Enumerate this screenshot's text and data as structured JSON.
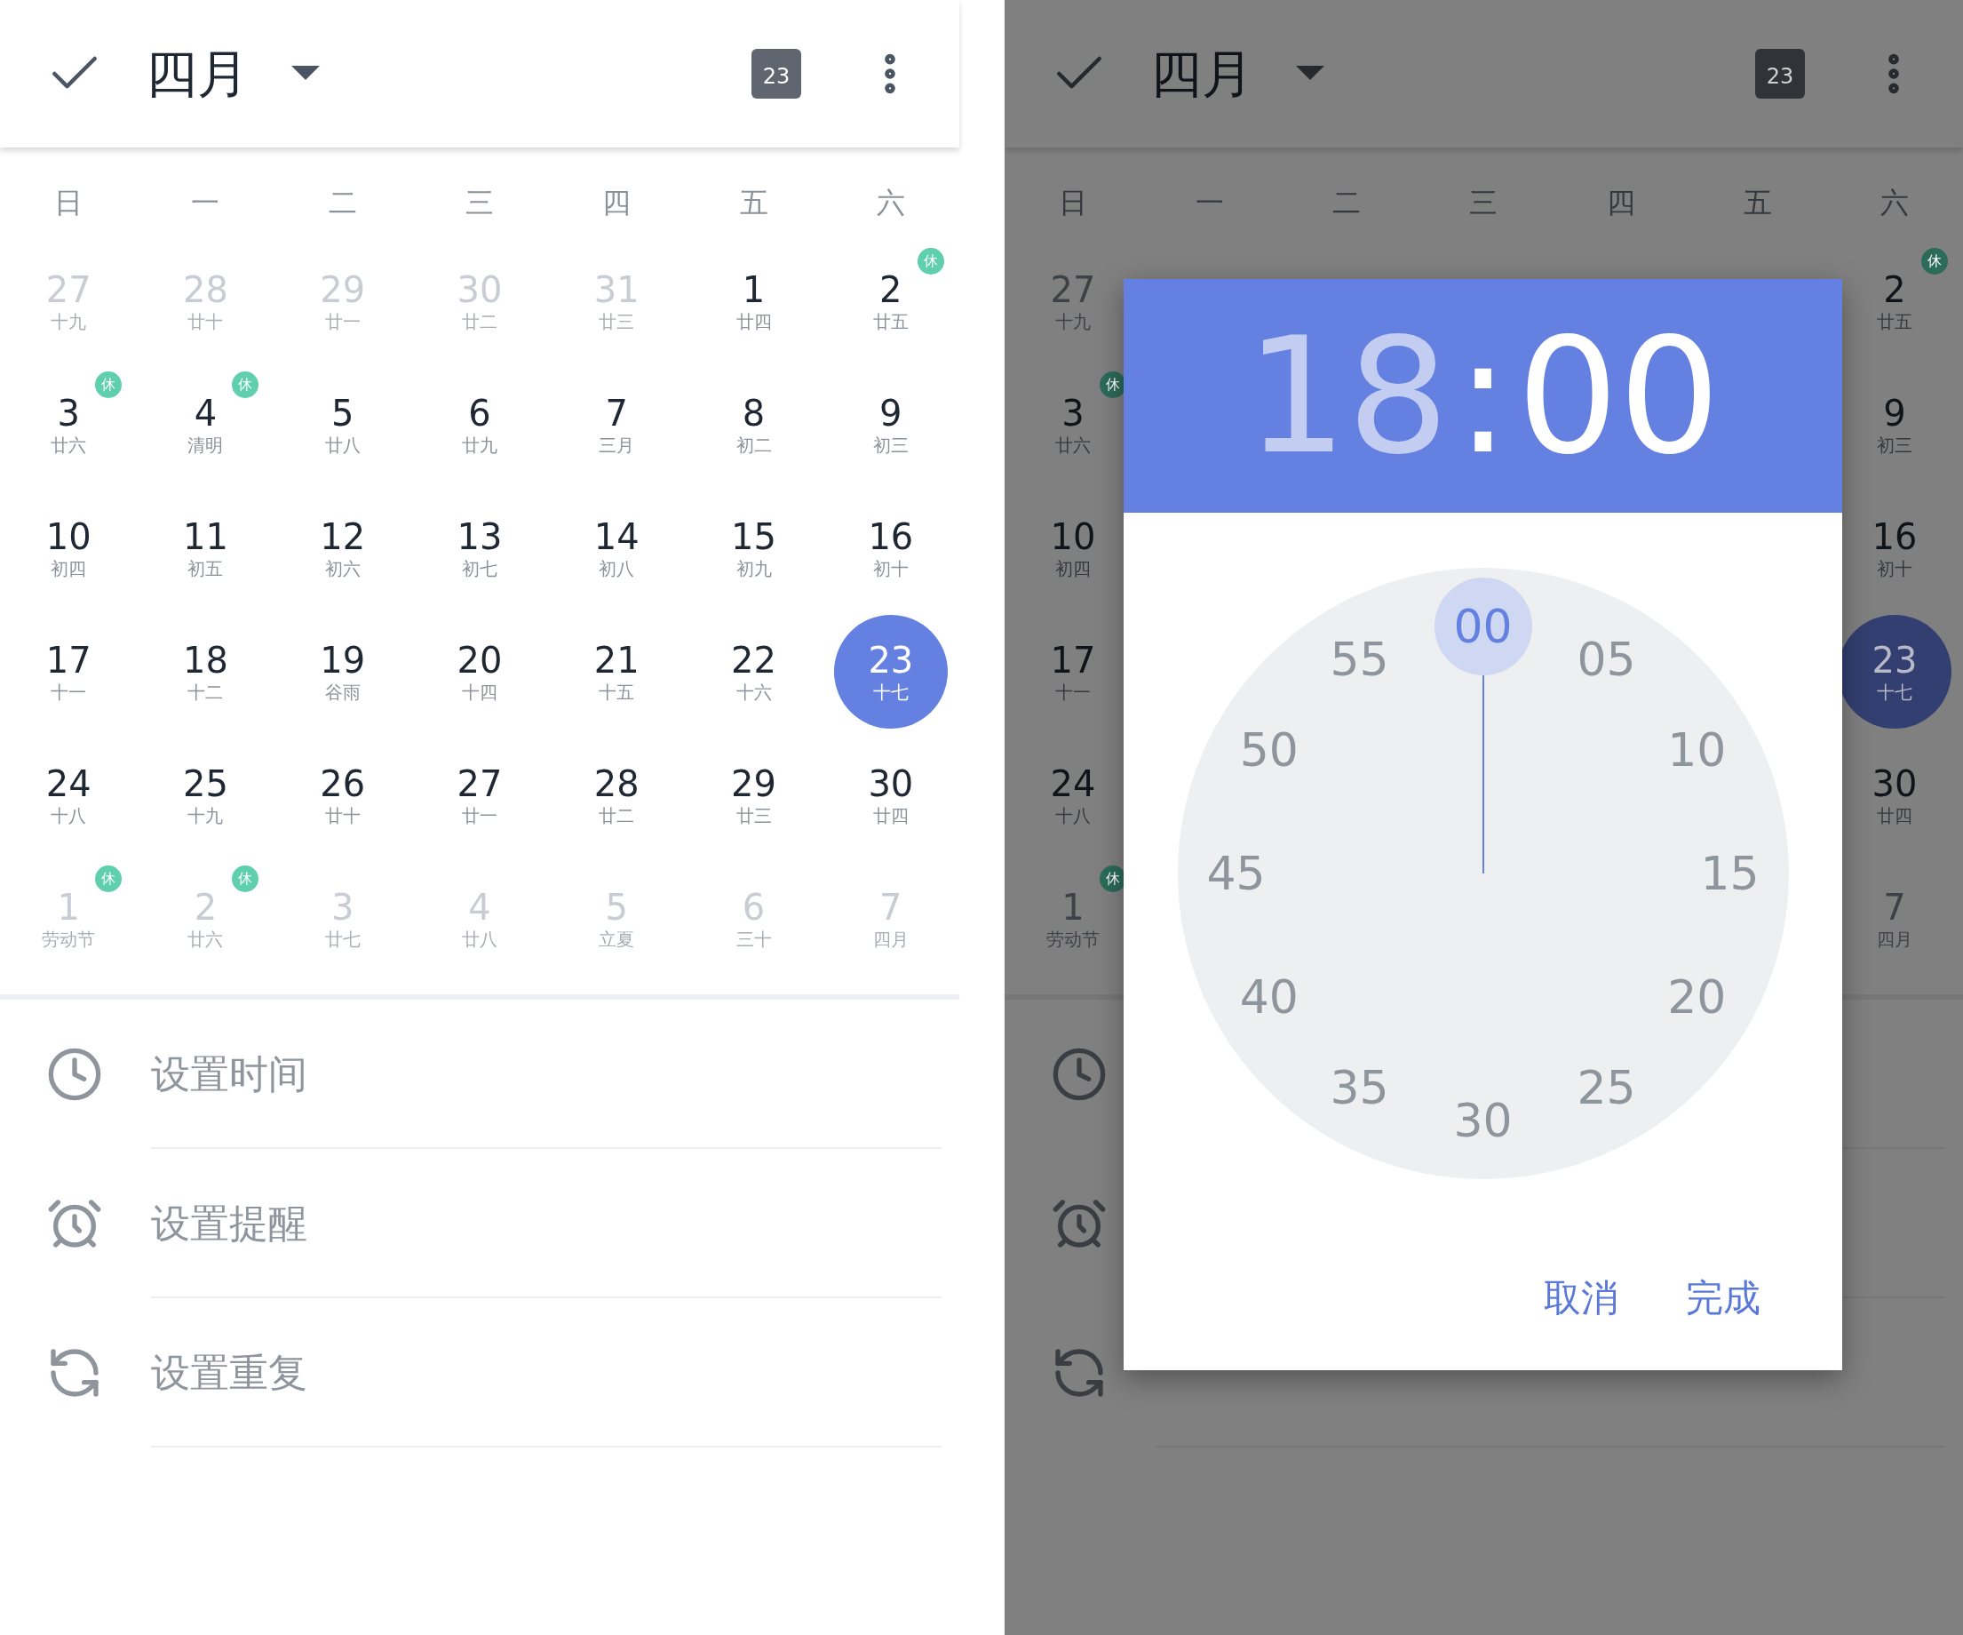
{
  "left": {
    "header": {
      "title": "四月",
      "today_badge": "23"
    },
    "weekdays": [
      "日",
      "一",
      "二",
      "三",
      "四",
      "五",
      "六"
    ],
    "weeks": [
      [
        {
          "day": "27",
          "lunar": "十九",
          "muted": true,
          "rest": false,
          "selected": false
        },
        {
          "day": "28",
          "lunar": "廿十",
          "muted": true,
          "rest": false,
          "selected": false
        },
        {
          "day": "29",
          "lunar": "廿一",
          "muted": true,
          "rest": false,
          "selected": false
        },
        {
          "day": "30",
          "lunar": "廿二",
          "muted": true,
          "rest": false,
          "selected": false
        },
        {
          "day": "31",
          "lunar": "廿三",
          "muted": true,
          "rest": false,
          "selected": false
        },
        {
          "day": "1",
          "lunar": "廿四",
          "muted": false,
          "rest": false,
          "selected": false
        },
        {
          "day": "2",
          "lunar": "廿五",
          "muted": false,
          "rest": true,
          "rest_label": "休",
          "selected": false
        }
      ],
      [
        {
          "day": "3",
          "lunar": "廿六",
          "muted": false,
          "rest": true,
          "rest_label": "休",
          "selected": false
        },
        {
          "day": "4",
          "lunar": "清明",
          "muted": false,
          "rest": true,
          "rest_label": "休",
          "selected": false
        },
        {
          "day": "5",
          "lunar": "廿八",
          "muted": false,
          "rest": false,
          "selected": false
        },
        {
          "day": "6",
          "lunar": "廿九",
          "muted": false,
          "rest": false,
          "selected": false
        },
        {
          "day": "7",
          "lunar": "三月",
          "muted": false,
          "rest": false,
          "selected": false
        },
        {
          "day": "8",
          "lunar": "初二",
          "muted": false,
          "rest": false,
          "selected": false
        },
        {
          "day": "9",
          "lunar": "初三",
          "muted": false,
          "rest": false,
          "selected": false
        }
      ],
      [
        {
          "day": "10",
          "lunar": "初四",
          "muted": false,
          "rest": false,
          "selected": false
        },
        {
          "day": "11",
          "lunar": "初五",
          "muted": false,
          "rest": false,
          "selected": false
        },
        {
          "day": "12",
          "lunar": "初六",
          "muted": false,
          "rest": false,
          "selected": false
        },
        {
          "day": "13",
          "lunar": "初七",
          "muted": false,
          "rest": false,
          "selected": false
        },
        {
          "day": "14",
          "lunar": "初八",
          "muted": false,
          "rest": false,
          "selected": false
        },
        {
          "day": "15",
          "lunar": "初九",
          "muted": false,
          "rest": false,
          "selected": false
        },
        {
          "day": "16",
          "lunar": "初十",
          "muted": false,
          "rest": false,
          "selected": false
        }
      ],
      [
        {
          "day": "17",
          "lunar": "十一",
          "muted": false,
          "rest": false,
          "selected": false
        },
        {
          "day": "18",
          "lunar": "十二",
          "muted": false,
          "rest": false,
          "selected": false
        },
        {
          "day": "19",
          "lunar": "谷雨",
          "muted": false,
          "rest": false,
          "selected": false
        },
        {
          "day": "20",
          "lunar": "十四",
          "muted": false,
          "rest": false,
          "selected": false
        },
        {
          "day": "21",
          "lunar": "十五",
          "muted": false,
          "rest": false,
          "selected": false
        },
        {
          "day": "22",
          "lunar": "十六",
          "muted": false,
          "rest": false,
          "selected": false
        },
        {
          "day": "23",
          "lunar": "十七",
          "muted": false,
          "rest": false,
          "selected": true
        }
      ],
      [
        {
          "day": "24",
          "lunar": "十八",
          "muted": false,
          "rest": false,
          "selected": false
        },
        {
          "day": "25",
          "lunar": "十九",
          "muted": false,
          "rest": false,
          "selected": false
        },
        {
          "day": "26",
          "lunar": "廿十",
          "muted": false,
          "rest": false,
          "selected": false
        },
        {
          "day": "27",
          "lunar": "廿一",
          "muted": false,
          "rest": false,
          "selected": false
        },
        {
          "day": "28",
          "lunar": "廿二",
          "muted": false,
          "rest": false,
          "selected": false
        },
        {
          "day": "29",
          "lunar": "廿三",
          "muted": false,
          "rest": false,
          "selected": false
        },
        {
          "day": "30",
          "lunar": "廿四",
          "muted": false,
          "rest": false,
          "selected": false
        }
      ],
      [
        {
          "day": "1",
          "lunar": "劳动节",
          "muted": true,
          "rest": true,
          "rest_label": "休",
          "selected": false
        },
        {
          "day": "2",
          "lunar": "廿六",
          "muted": true,
          "rest": true,
          "rest_label": "休",
          "selected": false
        },
        {
          "day": "3",
          "lunar": "廿七",
          "muted": true,
          "rest": false,
          "selected": false
        },
        {
          "day": "4",
          "lunar": "廿八",
          "muted": true,
          "rest": false,
          "selected": false
        },
        {
          "day": "5",
          "lunar": "立夏",
          "muted": true,
          "rest": false,
          "selected": false
        },
        {
          "day": "6",
          "lunar": "三十",
          "muted": true,
          "rest": false,
          "selected": false
        },
        {
          "day": "7",
          "lunar": "四月",
          "muted": true,
          "rest": false,
          "selected": false
        }
      ]
    ],
    "options": [
      {
        "kind": "time",
        "label": "设置时间"
      },
      {
        "kind": "alarm",
        "label": "设置提醒"
      },
      {
        "kind": "repeat",
        "label": "设置重复"
      }
    ]
  },
  "right": {
    "header": {
      "title": "四月",
      "today_badge": "23"
    },
    "weekdays": [
      "日",
      "一",
      "二",
      "三",
      "四",
      "五",
      "六"
    ],
    "weeks": [
      {
        "first": {
          "day": "27",
          "lunar": "十九",
          "muted": true,
          "rest": false,
          "selected": false
        },
        "last": {
          "day": "2",
          "lunar": "廿五",
          "muted": false,
          "rest": true,
          "rest_label": "休",
          "selected": false
        }
      },
      {
        "first": {
          "day": "3",
          "lunar": "廿六",
          "muted": false,
          "rest": true,
          "rest_label": "休",
          "selected": false
        },
        "last": {
          "day": "9",
          "lunar": "初三",
          "muted": false,
          "rest": false,
          "selected": false
        }
      },
      {
        "first": {
          "day": "10",
          "lunar": "初四",
          "muted": false,
          "rest": false,
          "selected": false
        },
        "last": {
          "day": "16",
          "lunar": "初十",
          "muted": false,
          "rest": false,
          "selected": false
        }
      },
      {
        "first": {
          "day": "17",
          "lunar": "十一",
          "muted": false,
          "rest": false,
          "selected": false
        },
        "last": {
          "day": "23",
          "lunar": "十七",
          "muted": false,
          "rest": false,
          "selected": true
        }
      },
      {
        "first": {
          "day": "24",
          "lunar": "十八",
          "muted": false,
          "rest": false,
          "selected": false
        },
        "last": {
          "day": "30",
          "lunar": "廿四",
          "muted": false,
          "rest": false,
          "selected": false
        }
      },
      {
        "first": {
          "day": "1",
          "lunar": "劳动节",
          "muted": true,
          "rest": true,
          "rest_label": "休",
          "selected": false
        },
        "last": {
          "day": "7",
          "lunar": "四月",
          "muted": true,
          "rest": false,
          "selected": false
        }
      }
    ],
    "options": [
      {
        "kind": "time"
      },
      {
        "kind": "alarm"
      },
      {
        "kind": "repeat"
      }
    ],
    "dialog": {
      "hour": {
        "text": "18",
        "selected": false
      },
      "separator": ":",
      "minute": {
        "text": "00",
        "selected": true
      },
      "dial": [
        {
          "label": "00",
          "selected": true
        },
        {
          "label": "05",
          "selected": false
        },
        {
          "label": "10",
          "selected": false
        },
        {
          "label": "15",
          "selected": false
        },
        {
          "label": "20",
          "selected": false
        },
        {
          "label": "25",
          "selected": false
        },
        {
          "label": "30",
          "selected": false
        },
        {
          "label": "35",
          "selected": false
        },
        {
          "label": "40",
          "selected": false
        },
        {
          "label": "45",
          "selected": false
        },
        {
          "label": "50",
          "selected": false
        },
        {
          "label": "55",
          "selected": false
        }
      ],
      "buttons": [
        "取消",
        "完成"
      ]
    }
  }
}
